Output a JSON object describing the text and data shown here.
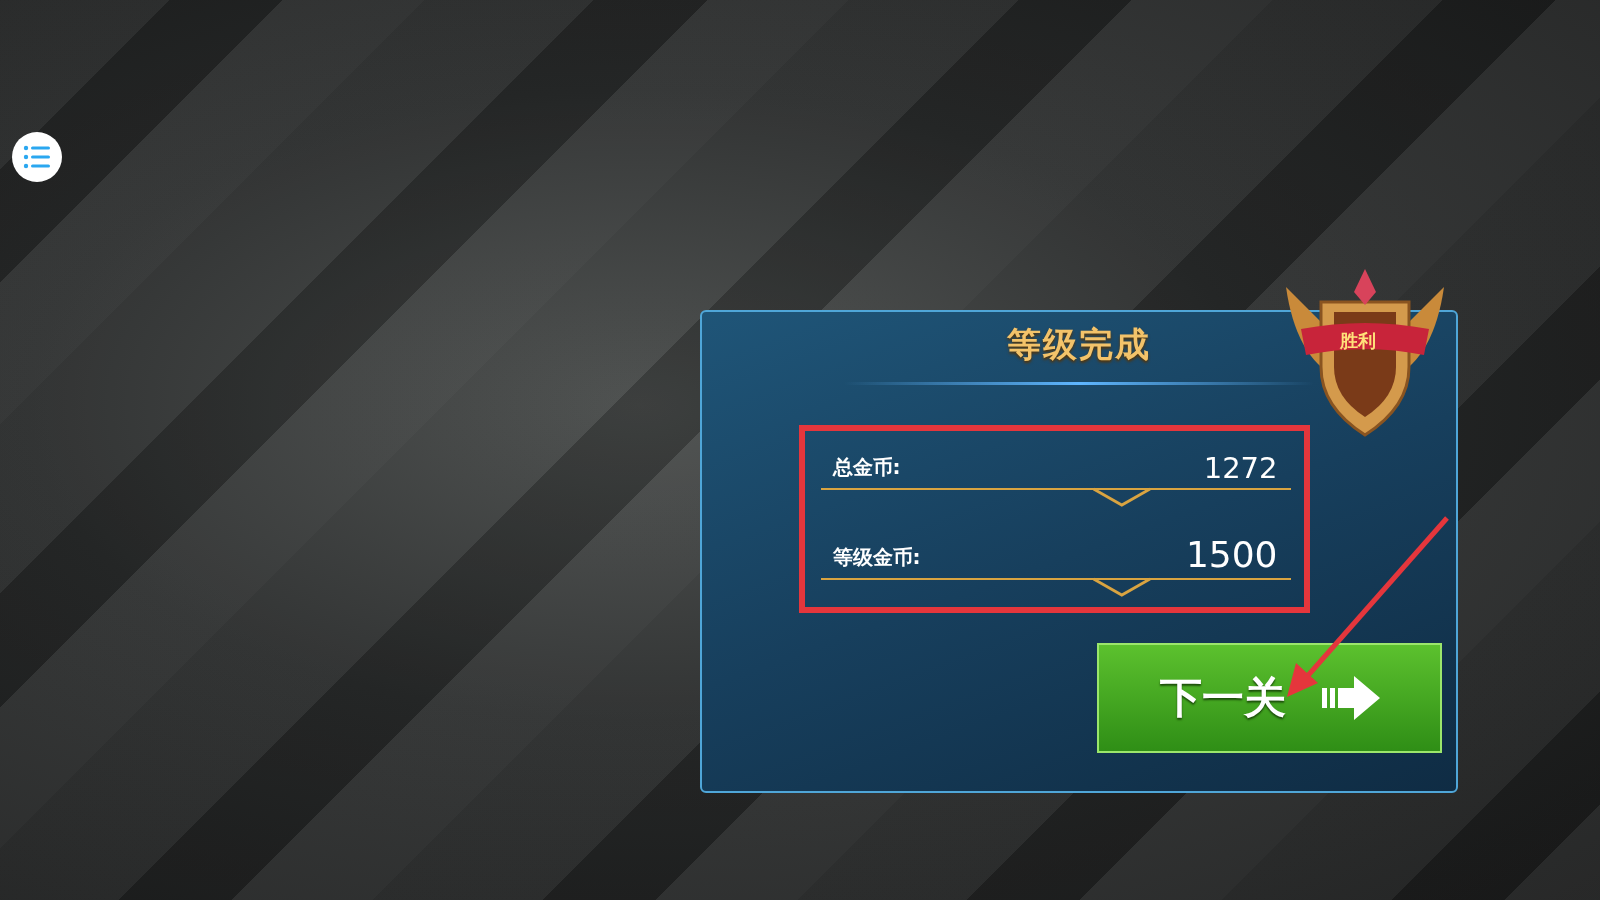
{
  "panel": {
    "title": "等级完成",
    "badge": "胜利"
  },
  "stats": [
    {
      "label": "总金币:",
      "value": "1272"
    },
    {
      "label": "等级金币:",
      "value": "1500"
    }
  ],
  "next_button": {
    "label": "下一关"
  }
}
